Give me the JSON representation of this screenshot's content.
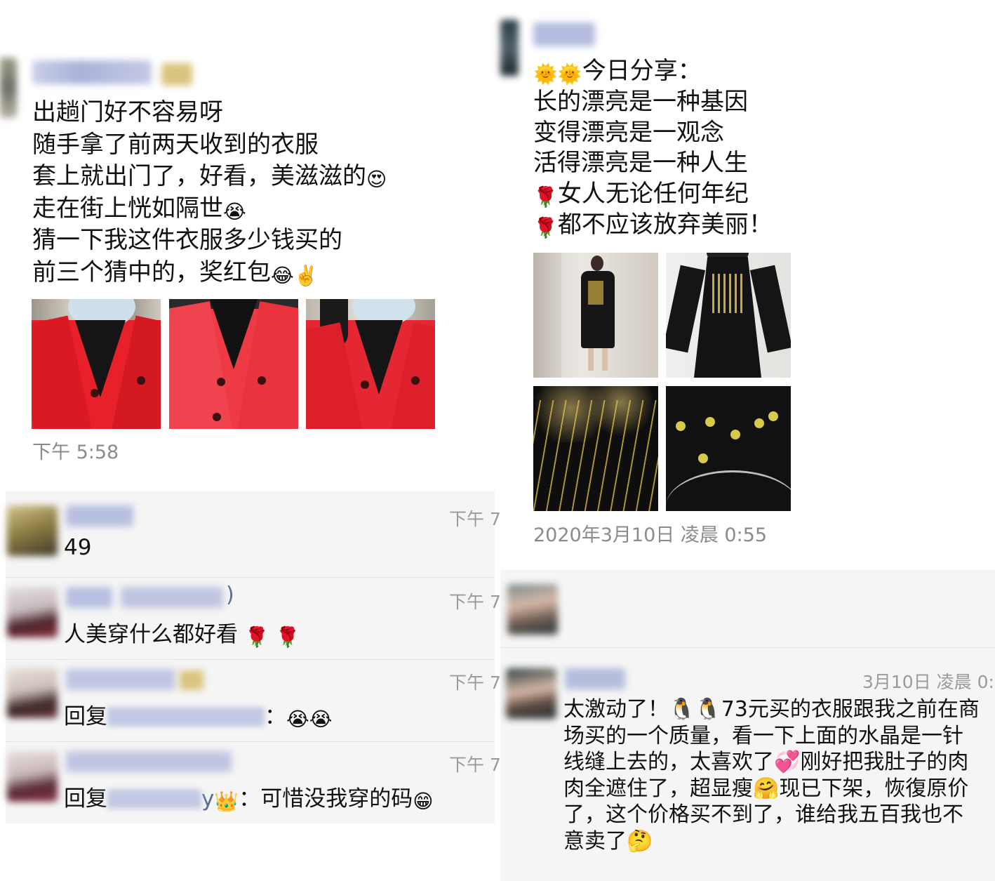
{
  "left_post": {
    "lines": [
      "出趟门好不容易呀",
      "随手拿了前两天收到的衣服",
      "套上就出门了，好看，美滋滋的",
      "走在街上恍如隔世",
      "猜一下我这件衣服多少钱买的",
      "前三个猜中的，奖红包"
    ],
    "line_emojis": [
      "",
      "",
      "😍",
      "😭",
      "",
      "😂✌️"
    ],
    "timestamp": "下午 5:58"
  },
  "left_comments": [
    {
      "time": "下午 7",
      "prefix": "",
      "text": "49",
      "trail": ""
    },
    {
      "time": "下午 7",
      "prefix": "",
      "text": "人美穿什么都好看",
      "trail": "🌹 🌹"
    },
    {
      "time": "下午 7",
      "prefix": "回复",
      "text": "：",
      "trail": "😭😭"
    },
    {
      "time": "下午 7",
      "prefix": "回复",
      "text": "：可惜没我穿的码",
      "trail": "😁"
    }
  ],
  "left_name_fragments": {
    "c2": ")",
    "c3": "",
    "c4": "y"
  },
  "right_post": {
    "lines": [
      "今日分享：",
      "长的漂亮是一种基因",
      "变得漂亮是一观念",
      "活得漂亮是一种人生",
      "女人无论任何年纪",
      "都不应该放弃美丽！"
    ],
    "line_emojis": [
      "🌞🌞",
      "",
      "",
      "",
      "🌹",
      "🌹"
    ],
    "timestamp": "2020年3月10日 凌晨 0:55"
  },
  "right_comment": {
    "time": "3月10日 凌晨 0:",
    "lines": [
      "太激动了！🐧🐧73元买的衣服跟我之前在商",
      "场买的一个质量，看一下上面的水晶是一针",
      "线缝上去的，太喜欢了💞刚好把我肚子的肉",
      "肉全遮住了，超显瘦🤗现已下架，恢復原价",
      "了，这个价格买不到了，谁给我五百我也不",
      "意卖了🤔"
    ]
  },
  "colors": {
    "coat_red": "#e8202a",
    "panel_bg": "#f5f5f5",
    "timestamp_gray": "#8b8b8b",
    "dress_black": "#141414",
    "embroidery_gold": "#c9a93a"
  },
  "icons": {
    "sun": "sun-emoji-icon",
    "rose": "rose-emoji-icon",
    "penguin": "penguin-emoji-icon"
  }
}
